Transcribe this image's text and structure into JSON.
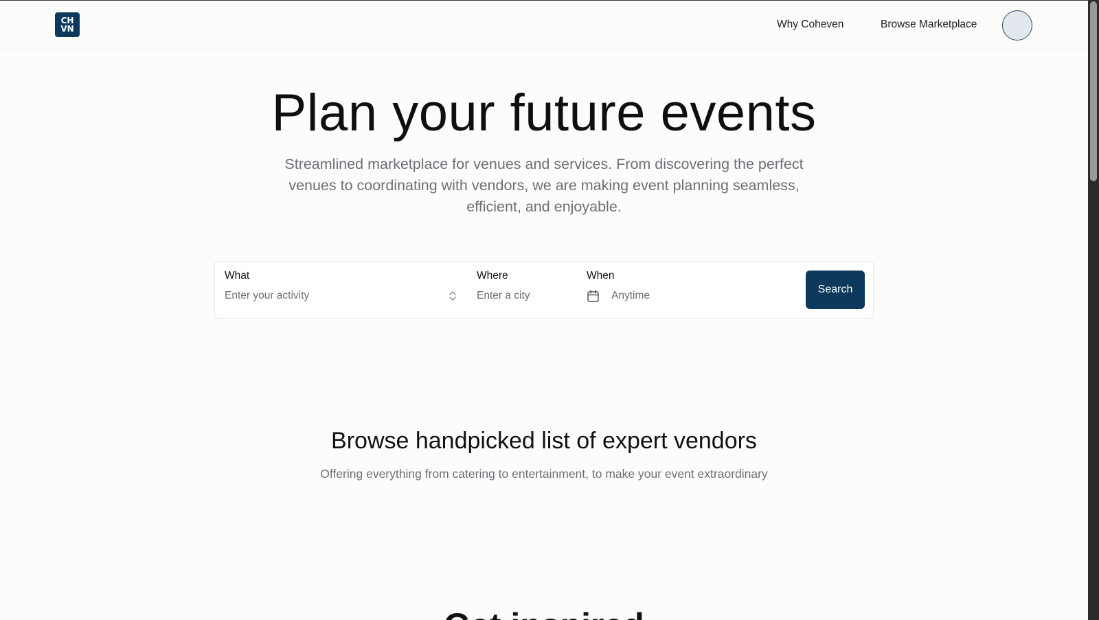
{
  "header": {
    "logo_top": "CH",
    "logo_bottom": "VN",
    "nav": [
      {
        "label": "Why Coheven"
      },
      {
        "label": "Browse Marketplace"
      }
    ]
  },
  "hero": {
    "title": "Plan your future events",
    "subtitle": "Streamlined marketplace for venues and services. From discovering the perfect venues to coordinating with vendors, we are making event planning seamless, efficient, and enjoyable."
  },
  "search": {
    "what_label": "What",
    "what_placeholder": "Enter your activity",
    "where_label": "Where",
    "where_placeholder": "Enter a city",
    "when_label": "When",
    "when_value": "Anytime",
    "button_label": "Search"
  },
  "vendors": {
    "title": "Browse handpicked list of expert vendors",
    "subtitle": "Offering everything from catering to entertainment, to make your event extraordinary"
  },
  "next_section": {
    "title": "Get inspired"
  },
  "colors": {
    "brand": "#0d3a5c",
    "background": "#fcfcfa",
    "muted_text": "#6b6f78"
  }
}
